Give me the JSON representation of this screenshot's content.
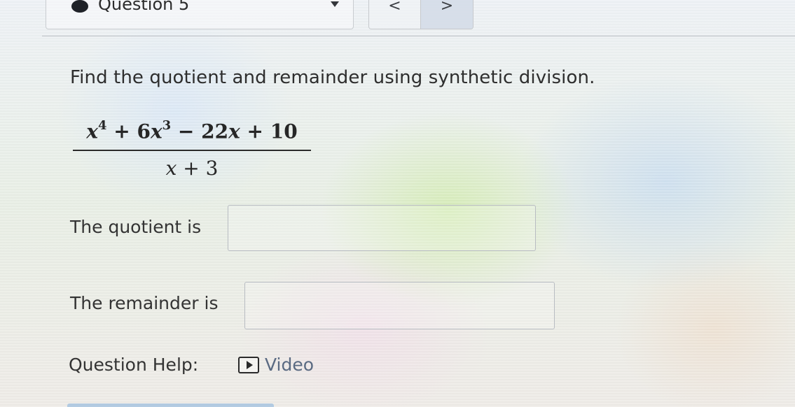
{
  "header": {
    "question_label": "Question 5",
    "prev_label": "<",
    "next_label": ">"
  },
  "problem": {
    "instruction": "Find the quotient and remainder using synthetic division.",
    "numerator": "x⁴ + 6x³ − 22x + 10",
    "denominator": "x + 3"
  },
  "answers": {
    "quotient_label": "The quotient is",
    "quotient_value": "",
    "remainder_label": "The remainder is",
    "remainder_value": ""
  },
  "help": {
    "label": "Question Help:",
    "video_label": "Video"
  }
}
